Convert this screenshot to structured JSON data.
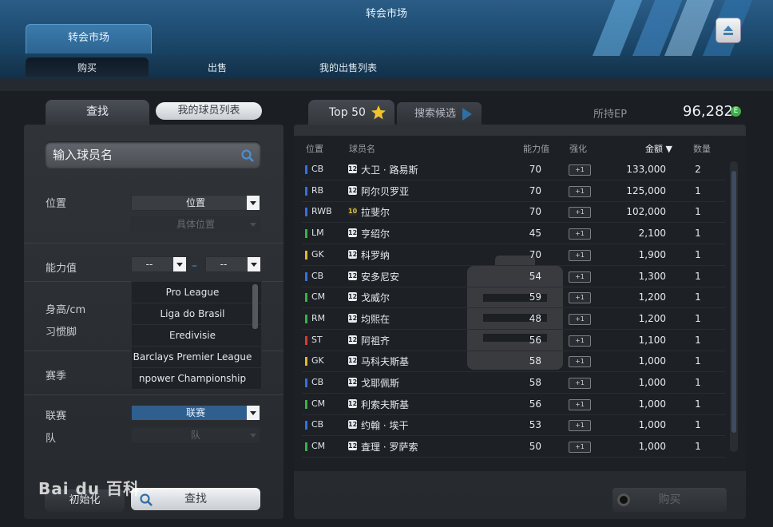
{
  "window": {
    "title": "转会市场"
  },
  "header": {
    "tab_label": "转会市场"
  },
  "subtabs": {
    "buy": "购买",
    "sell": "出售",
    "my_sale_list": "我的出售列表"
  },
  "left": {
    "tab_search": "查找",
    "tab_player_list": "我的球员列表",
    "name_placeholder": "输入球员名",
    "position_label": "位置",
    "position_select": "位置",
    "position_detail_select": "具体位置",
    "ability_label": "能力值",
    "ability_min": "--",
    "ability_max": "--",
    "ability_dash": "–",
    "height_label": "身高/cm",
    "foot_label": "习惯脚",
    "season_label": "赛季",
    "league_options": [
      "Pro League",
      "Liga do Brasil",
      "Eredivisie",
      "Barclays Premier League",
      "npower Championship"
    ],
    "league_label": "联赛",
    "league_select": "联赛",
    "team_label": "队",
    "team_select": "队",
    "reset_button": "初始化",
    "search_button": "查找"
  },
  "right": {
    "tab_top50": "Top 50",
    "tab_candidates": "搜索候选",
    "ep_label": "所持EP",
    "ep_value": "96,282",
    "ep_icon_letter": "E",
    "columns": {
      "position": "位置",
      "name": "球员名",
      "ability": "能力值",
      "enhance": "强化",
      "price": "金额 ▼",
      "qty": "数量"
    },
    "buy_button": "购买",
    "rows": [
      {
        "pos": "CB",
        "pos_color": "#3b6fd6",
        "badge": "12",
        "name": "大卫 · 路易斯",
        "ovr": "70",
        "enh": "+1",
        "price": "133,000",
        "qty": "2"
      },
      {
        "pos": "RB",
        "pos_color": "#3b6fd6",
        "badge": "12",
        "name": "阿尔贝罗亚",
        "ovr": "70",
        "enh": "+1",
        "price": "125,000",
        "qty": "1"
      },
      {
        "pos": "RWB",
        "pos_color": "#3b6fd6",
        "badge": "10",
        "name": "拉斐尔",
        "ovr": "70",
        "enh": "+1",
        "price": "102,000",
        "qty": "1"
      },
      {
        "pos": "LM",
        "pos_color": "#3fae4a",
        "badge": "12",
        "name": "亨绍尔",
        "ovr": "45",
        "enh": "+1",
        "price": "2,100",
        "qty": "1"
      },
      {
        "pos": "GK",
        "pos_color": "#e0b93a",
        "badge": "12",
        "name": "科罗纳",
        "ovr": "70",
        "enh": "+1",
        "price": "1,900",
        "qty": "1"
      },
      {
        "pos": "CB",
        "pos_color": "#3b6fd6",
        "badge": "12",
        "name": "安多尼安",
        "ovr": "54",
        "enh": "+1",
        "price": "1,300",
        "qty": "1"
      },
      {
        "pos": "CM",
        "pos_color": "#3fae4a",
        "badge": "12",
        "name": "戈威尔",
        "ovr": "59",
        "enh": "+1",
        "price": "1,200",
        "qty": "1"
      },
      {
        "pos": "RM",
        "pos_color": "#3fae4a",
        "badge": "12",
        "name": "均熙在",
        "ovr": "48",
        "enh": "+1",
        "price": "1,200",
        "qty": "1"
      },
      {
        "pos": "ST",
        "pos_color": "#d63b3b",
        "badge": "12",
        "name": "阿祖齐",
        "ovr": "56",
        "enh": "+1",
        "price": "1,100",
        "qty": "1"
      },
      {
        "pos": "GK",
        "pos_color": "#e0b93a",
        "badge": "12",
        "name": "马科夫斯基",
        "ovr": "58",
        "enh": "+1",
        "price": "1,000",
        "qty": "1"
      },
      {
        "pos": "CB",
        "pos_color": "#3b6fd6",
        "badge": "12",
        "name": "戈耶佩斯",
        "ovr": "58",
        "enh": "+1",
        "price": "1,000",
        "qty": "1"
      },
      {
        "pos": "CM",
        "pos_color": "#3fae4a",
        "badge": "12",
        "name": "利索夫斯基",
        "ovr": "56",
        "enh": "+1",
        "price": "1,000",
        "qty": "1"
      },
      {
        "pos": "CB",
        "pos_color": "#3b6fd6",
        "badge": "12",
        "name": "约翰 · 埃干",
        "ovr": "53",
        "enh": "+1",
        "price": "1,000",
        "qty": "1"
      },
      {
        "pos": "CM",
        "pos_color": "#3fae4a",
        "badge": "12",
        "name": "査理 · 罗萨索",
        "ovr": "50",
        "enh": "+1",
        "price": "1,000",
        "qty": "1"
      }
    ]
  },
  "watermark": {
    "text": "Bai du 百科"
  },
  "colors": {
    "accent": "#2f5f8e",
    "header": "#1f4d73",
    "ep_green": "#3fae4a"
  }
}
